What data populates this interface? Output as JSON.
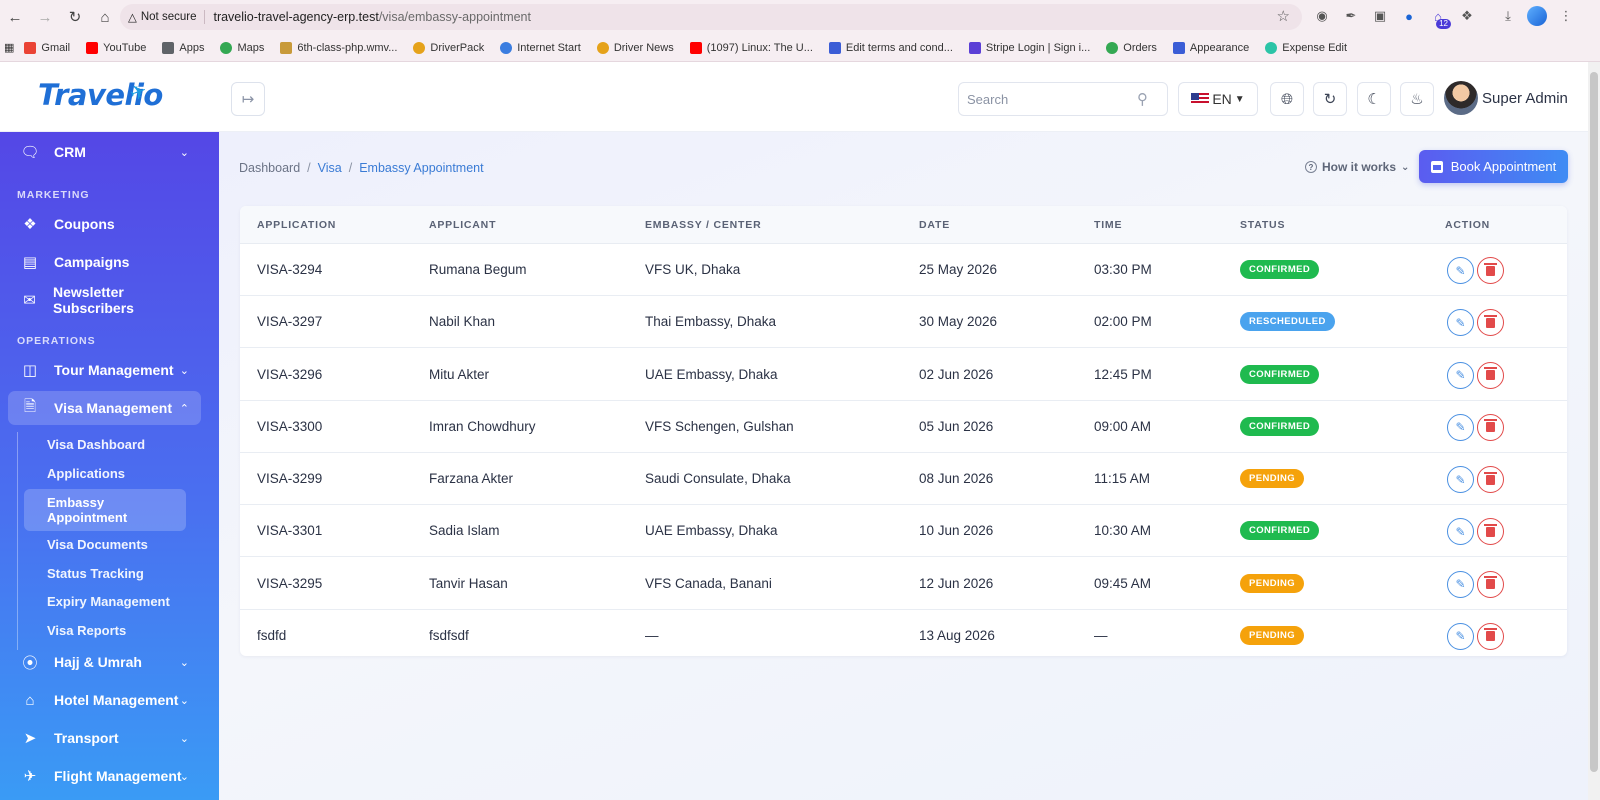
{
  "browser": {
    "security_label": "Not secure",
    "url_host": "travelio-travel-agency-erp.test",
    "url_path": "/visa/embassy-appointment",
    "extension_badge": "12",
    "bookmarks": [
      {
        "label": "Gmail",
        "color": "#ea4335"
      },
      {
        "label": "YouTube",
        "color": "#ff0000"
      },
      {
        "label": "Apps",
        "color": "#5f6368"
      },
      {
        "label": "Maps",
        "color": "#34a853"
      },
      {
        "label": "6th-class-php.wmv...",
        "color": "#c89a3a"
      },
      {
        "label": "DriverPack",
        "color": "#e5a21a"
      },
      {
        "label": "Internet Start",
        "color": "#3b7de0"
      },
      {
        "label": "Driver News",
        "color": "#e5a21a"
      },
      {
        "label": "(1097) Linux: The U...",
        "color": "#ff0000"
      },
      {
        "label": "Edit terms and cond...",
        "color": "#3b5dd6"
      },
      {
        "label": "Stripe Login | Sign i...",
        "color": "#5b3fd6"
      },
      {
        "label": "Orders",
        "color": "#34a853"
      },
      {
        "label": "Appearance",
        "color": "#3b5dd6"
      },
      {
        "label": "Expense Edit",
        "color": "#2bc4a7"
      }
    ]
  },
  "header": {
    "logo_text": "Travelio",
    "search_placeholder": "Search",
    "language": "EN",
    "user_name": "Super Admin"
  },
  "sidebar": {
    "crm": "CRM",
    "section_marketing": "MARKETING",
    "coupons": "Coupons",
    "campaigns": "Campaigns",
    "newsletter": "Newsletter Subscribers",
    "section_operations": "OPERATIONS",
    "tour": "Tour Management",
    "visa": "Visa Management",
    "visa_sub": [
      "Visa Dashboard",
      "Applications",
      "Embassy Appointment",
      "Visa Documents",
      "Status Tracking",
      "Expiry Management",
      "Visa Reports"
    ],
    "hajj": "Hajj & Umrah",
    "hotel": "Hotel Management",
    "transport": "Transport",
    "flight": "Flight Management"
  },
  "breadcrumb": {
    "home": "Dashboard",
    "section": "Visa",
    "current": "Embassy Appointment"
  },
  "toolbar": {
    "how_it_works": "How it works",
    "book_appointment": "Book Appointment"
  },
  "table": {
    "headers": [
      "APPLICATION",
      "APPLICANT",
      "EMBASSY / CENTER",
      "DATE",
      "TIME",
      "STATUS",
      "ACTION"
    ],
    "rows": [
      {
        "application": "VISA-3294",
        "applicant": "Rumana Begum",
        "embassy": "VFS UK, Dhaka",
        "date": "25 May 2026",
        "time": "03:30 PM",
        "status": "CONFIRMED"
      },
      {
        "application": "VISA-3297",
        "applicant": "Nabil Khan",
        "embassy": "Thai Embassy, Dhaka",
        "date": "30 May 2026",
        "time": "02:00 PM",
        "status": "RESCHEDULED"
      },
      {
        "application": "VISA-3296",
        "applicant": "Mitu Akter",
        "embassy": "UAE Embassy, Dhaka",
        "date": "02 Jun 2026",
        "time": "12:45 PM",
        "status": "CONFIRMED"
      },
      {
        "application": "VISA-3300",
        "applicant": "Imran Chowdhury",
        "embassy": "VFS Schengen, Gulshan",
        "date": "05 Jun 2026",
        "time": "09:00 AM",
        "status": "CONFIRMED"
      },
      {
        "application": "VISA-3299",
        "applicant": "Farzana Akter",
        "embassy": "Saudi Consulate, Dhaka",
        "date": "08 Jun 2026",
        "time": "11:15 AM",
        "status": "PENDING"
      },
      {
        "application": "VISA-3301",
        "applicant": "Sadia Islam",
        "embassy": "UAE Embassy, Dhaka",
        "date": "10 Jun 2026",
        "time": "10:30 AM",
        "status": "CONFIRMED"
      },
      {
        "application": "VISA-3295",
        "applicant": "Tanvir Hasan",
        "embassy": "VFS Canada, Banani",
        "date": "12 Jun 2026",
        "time": "09:45 AM",
        "status": "PENDING"
      },
      {
        "application": "fsdfd",
        "applicant": "fsdfsdf",
        "embassy": "—",
        "date": "13 Aug 2026",
        "time": "—",
        "status": "PENDING"
      }
    ]
  },
  "colors": {
    "accent": "#3a7bd5",
    "confirmed": "#1fba4f",
    "rescheduled": "#4aa3ee",
    "pending": "#f5a20b",
    "delete": "#e24a4a"
  }
}
